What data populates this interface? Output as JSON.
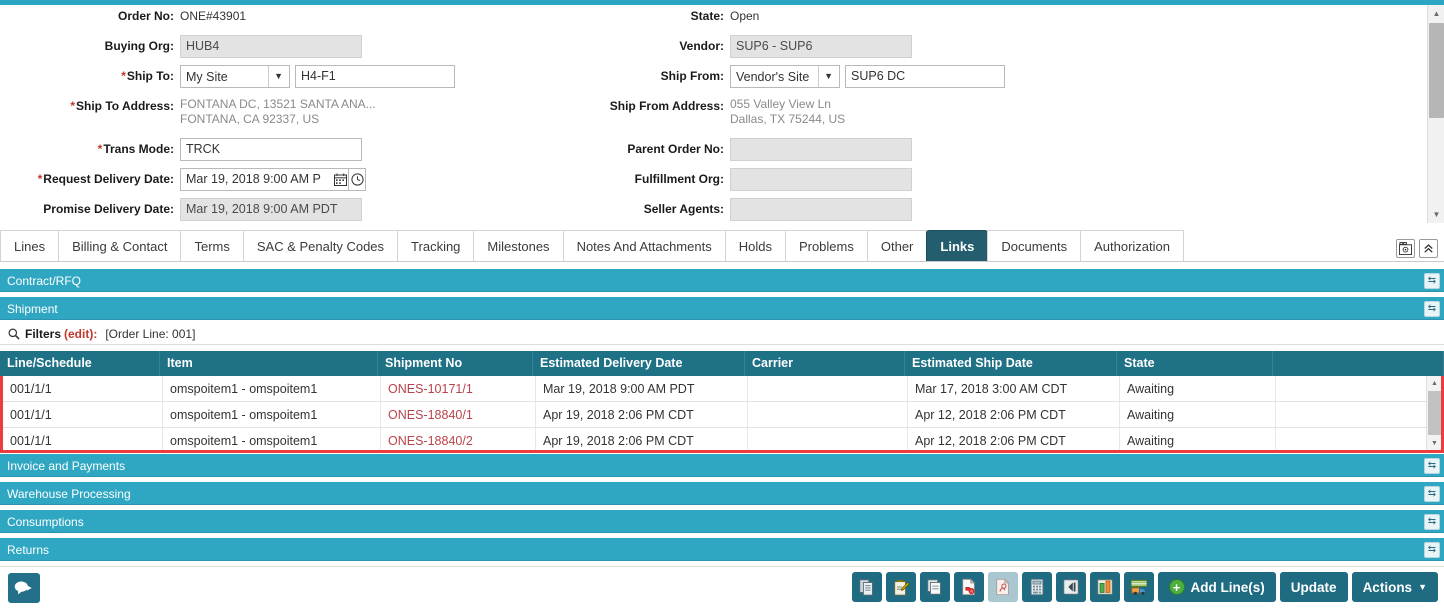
{
  "form": {
    "left": [
      {
        "label": "Order No:",
        "required": false,
        "type": "text",
        "value": "ONE#43901"
      },
      {
        "label": "Buying Org:",
        "required": false,
        "type": "input-readonly",
        "value": "HUB4"
      },
      {
        "label": "Ship To:",
        "required": true,
        "type": "select-input",
        "select_value": "My Site",
        "value": "H4-F1"
      },
      {
        "label": "Ship To Address:",
        "required": true,
        "type": "multiline",
        "line1": "FONTANA DC, 13521 SANTA ANA...",
        "line2": "FONTANA, CA 92337, US"
      },
      {
        "label": "Trans Mode:",
        "required": true,
        "type": "input",
        "value": "TRCK"
      },
      {
        "label": "Request Delivery Date:",
        "required": true,
        "type": "date",
        "value": "Mar 19, 2018 9:00 AM P"
      },
      {
        "label": "Promise Delivery Date:",
        "required": false,
        "type": "input-readonly",
        "value": "Mar 19, 2018 9:00 AM PDT"
      }
    ],
    "right": [
      {
        "label": "State:",
        "required": false,
        "type": "text",
        "value": "Open"
      },
      {
        "label": "Vendor:",
        "required": false,
        "type": "input-readonly",
        "value": "SUP6 - SUP6"
      },
      {
        "label": "Ship From:",
        "required": false,
        "type": "select-input",
        "select_value": "Vendor's Site",
        "value": "SUP6 DC"
      },
      {
        "label": "Ship From Address:",
        "required": false,
        "type": "multiline",
        "line1": "055 Valley View Ln",
        "line2": "Dallas, TX 75244, US"
      },
      {
        "label": "Parent Order No:",
        "required": false,
        "type": "input-readonly",
        "value": ""
      },
      {
        "label": "Fulfillment Org:",
        "required": false,
        "type": "input-readonly",
        "value": ""
      },
      {
        "label": "Seller Agents:",
        "required": false,
        "type": "input-readonly",
        "value": ""
      }
    ]
  },
  "tabs": [
    {
      "label": "Lines",
      "active": false
    },
    {
      "label": "Billing & Contact",
      "active": false
    },
    {
      "label": "Terms",
      "active": false
    },
    {
      "label": "SAC & Penalty Codes",
      "active": false
    },
    {
      "label": "Tracking",
      "active": false
    },
    {
      "label": "Milestones",
      "active": false
    },
    {
      "label": "Notes And Attachments",
      "active": false
    },
    {
      "label": "Holds",
      "active": false
    },
    {
      "label": "Problems",
      "active": false
    },
    {
      "label": "Other",
      "active": false
    },
    {
      "label": "Links",
      "active": true
    },
    {
      "label": "Documents",
      "active": false
    },
    {
      "label": "Authorization",
      "active": false
    }
  ],
  "sections": {
    "contract": "Contract/RFQ",
    "shipment": "Shipment",
    "invoice": "Invoice and Payments",
    "warehouse": "Warehouse Processing",
    "consumptions": "Consumptions",
    "returns": "Returns"
  },
  "filters": {
    "label": "Filters",
    "edit": "(edit):",
    "criteria": "[Order Line: 001]"
  },
  "table": {
    "columns": [
      "Line/Schedule",
      "Item",
      "Shipment No",
      "Estimated Delivery Date",
      "Carrier",
      "Estimated Ship Date",
      "State",
      ""
    ],
    "rows": [
      {
        "line_schedule": "001/1/1",
        "item": "omspoitem1 - omspoitem1",
        "shipment_no": "ONES-10171/1",
        "estimated_delivery_date": "Mar 19, 2018 9:00 AM PDT",
        "carrier": "",
        "estimated_ship_date": "Mar 17, 2018 3:00 AM CDT",
        "state": "Awaiting",
        "extra": ""
      },
      {
        "line_schedule": "001/1/1",
        "item": "omspoitem1 - omspoitem1",
        "shipment_no": "ONES-18840/1",
        "estimated_delivery_date": "Apr 19, 2018 2:06 PM CDT",
        "carrier": "",
        "estimated_ship_date": "Apr 12, 2018 2:06 PM CDT",
        "state": "Awaiting",
        "extra": ""
      },
      {
        "line_schedule": "001/1/1",
        "item": "omspoitem1 - omspoitem1",
        "shipment_no": "ONES-18840/2",
        "estimated_delivery_date": "Apr 19, 2018 2:06 PM CDT",
        "carrier": "",
        "estimated_ship_date": "Apr 12, 2018 2:06 PM CDT",
        "state": "Awaiting",
        "extra": ""
      }
    ]
  },
  "toolbar": {
    "icons": [
      "copy-document-icon",
      "edit-contract-icon",
      "duplicate-pages-icon",
      "pdf-export-icon",
      "pdf-view-icon",
      "calculator-icon",
      "collapse-left-icon",
      "chart-columns-icon",
      "shipment-truck-icon"
    ],
    "add_lines_label": "Add Line(s)",
    "update_label": "Update",
    "actions_label": "Actions"
  },
  "colors": {
    "accent_teal": "#2fa7c3",
    "header_teal": "#1f7186",
    "active_tab": "#245d6e",
    "highlight_red": "#ef3b3b",
    "link_red": "#b8434a",
    "button_teal": "#1f6c82",
    "green": "#4caf3f"
  }
}
